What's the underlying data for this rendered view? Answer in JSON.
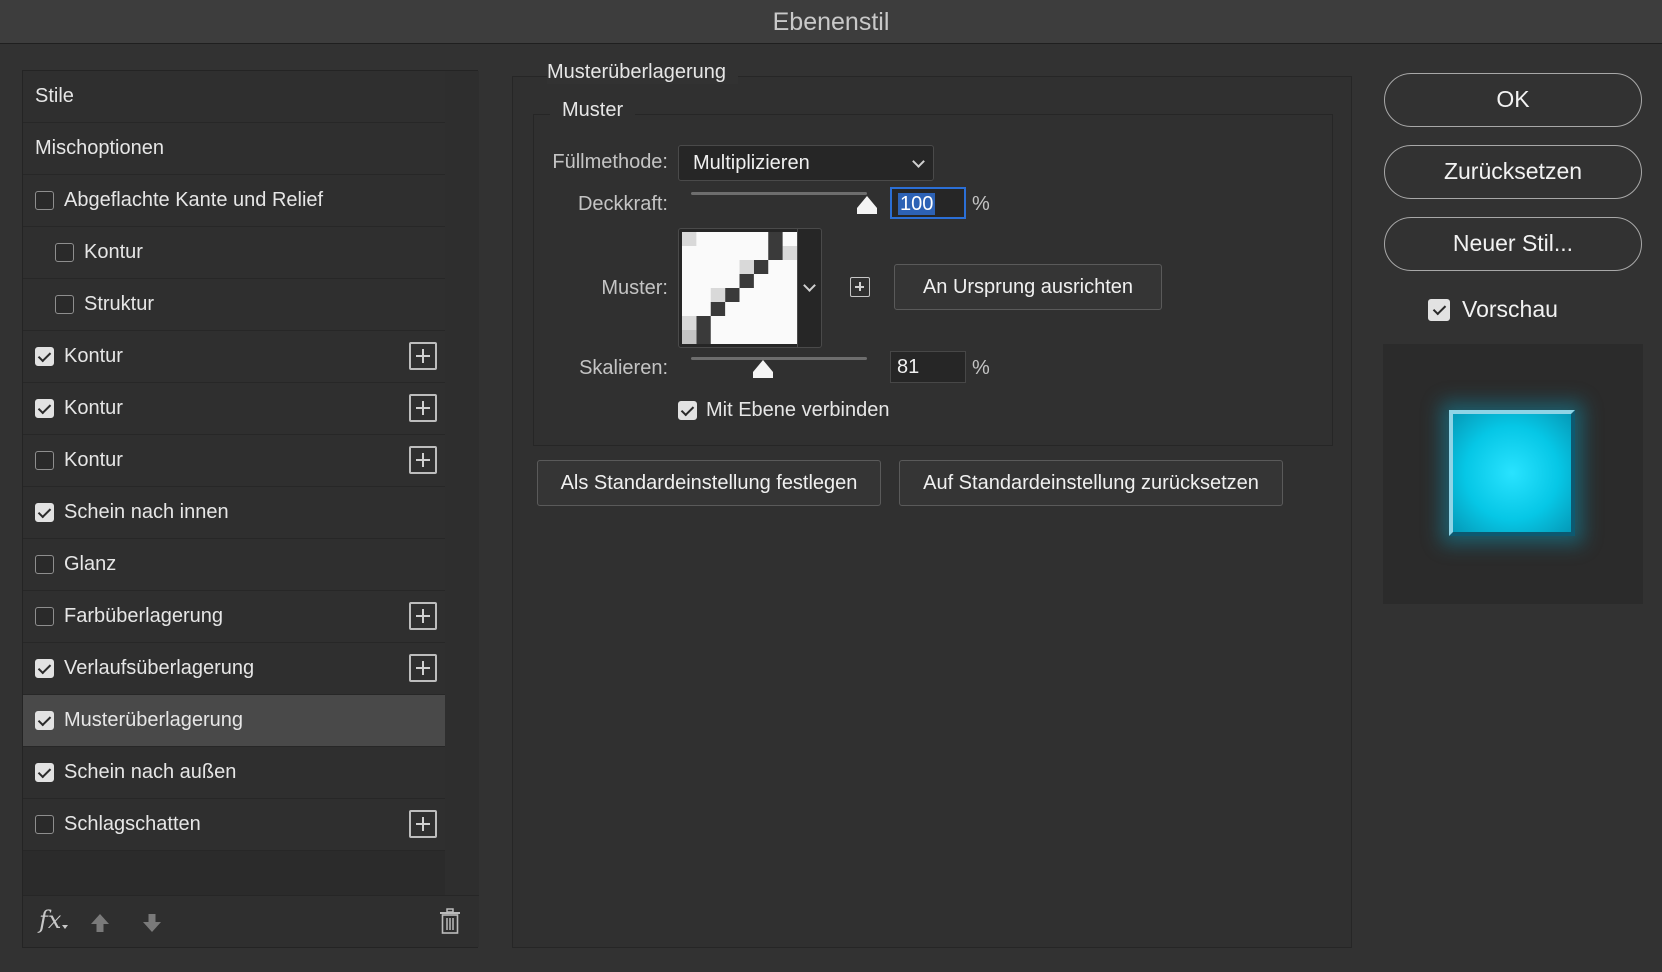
{
  "window": {
    "title": "Ebenenstil"
  },
  "styles": {
    "items": [
      {
        "label": "Stile",
        "checkbox": false,
        "checked": false,
        "plus": false,
        "indent": false,
        "selected": false
      },
      {
        "label": "Mischoptionen",
        "checkbox": false,
        "checked": false,
        "plus": false,
        "indent": false,
        "selected": false
      },
      {
        "label": "Abgeflachte Kante und Relief",
        "checkbox": true,
        "checked": false,
        "plus": false,
        "indent": false,
        "selected": false
      },
      {
        "label": "Kontur",
        "checkbox": true,
        "checked": false,
        "plus": false,
        "indent": true,
        "selected": false
      },
      {
        "label": "Struktur",
        "checkbox": true,
        "checked": false,
        "plus": false,
        "indent": true,
        "selected": false
      },
      {
        "label": "Kontur",
        "checkbox": true,
        "checked": true,
        "plus": true,
        "indent": false,
        "selected": false
      },
      {
        "label": "Kontur",
        "checkbox": true,
        "checked": true,
        "plus": true,
        "indent": false,
        "selected": false
      },
      {
        "label": "Kontur",
        "checkbox": true,
        "checked": false,
        "plus": true,
        "indent": false,
        "selected": false
      },
      {
        "label": "Schein nach innen",
        "checkbox": true,
        "checked": true,
        "plus": false,
        "indent": false,
        "selected": false
      },
      {
        "label": "Glanz",
        "checkbox": true,
        "checked": false,
        "plus": false,
        "indent": false,
        "selected": false
      },
      {
        "label": "Farbüberlagerung",
        "checkbox": true,
        "checked": false,
        "plus": true,
        "indent": false,
        "selected": false
      },
      {
        "label": "Verlaufsüberlagerung",
        "checkbox": true,
        "checked": true,
        "plus": true,
        "indent": false,
        "selected": false
      },
      {
        "label": "Musterüberlagerung",
        "checkbox": true,
        "checked": true,
        "plus": false,
        "indent": false,
        "selected": true
      },
      {
        "label": "Schein nach außen",
        "checkbox": true,
        "checked": true,
        "plus": false,
        "indent": false,
        "selected": false
      },
      {
        "label": "Schlagschatten",
        "checkbox": true,
        "checked": false,
        "plus": true,
        "indent": false,
        "selected": false
      }
    ],
    "footer": {
      "fx_label": "fx",
      "icons": [
        "fx-menu-icon",
        "move-up-icon",
        "move-down-icon",
        "trash-icon"
      ]
    }
  },
  "pattern_overlay": {
    "group_title": "Musterüberlagerung",
    "subgroup_title": "Muster",
    "blend_mode_label": "Füllmethode:",
    "blend_mode_value": "Multiplizieren",
    "opacity_label": "Deckkraft:",
    "opacity_value": "100",
    "opacity_level": 1.0,
    "percent": "%",
    "pattern_label": "Muster:",
    "snap_button": "An Ursprung ausrichten",
    "scale_label": "Skalieren:",
    "scale_value": "81",
    "scale_level": 0.41,
    "link_label": "Mit Ebene verbinden",
    "link_checked": true,
    "make_default_button": "Als Standardeinstellung festlegen",
    "reset_default_button": "Auf Standardeinstellung zurücksetzen"
  },
  "actions": {
    "ok": "OK",
    "reset": "Zurücksetzen",
    "new_style": "Neuer Stil...",
    "preview_label": "Vorschau",
    "preview_checked": true
  },
  "colors": {
    "accent": "#2b6fd6",
    "preview_fill": "#06c7e6"
  }
}
